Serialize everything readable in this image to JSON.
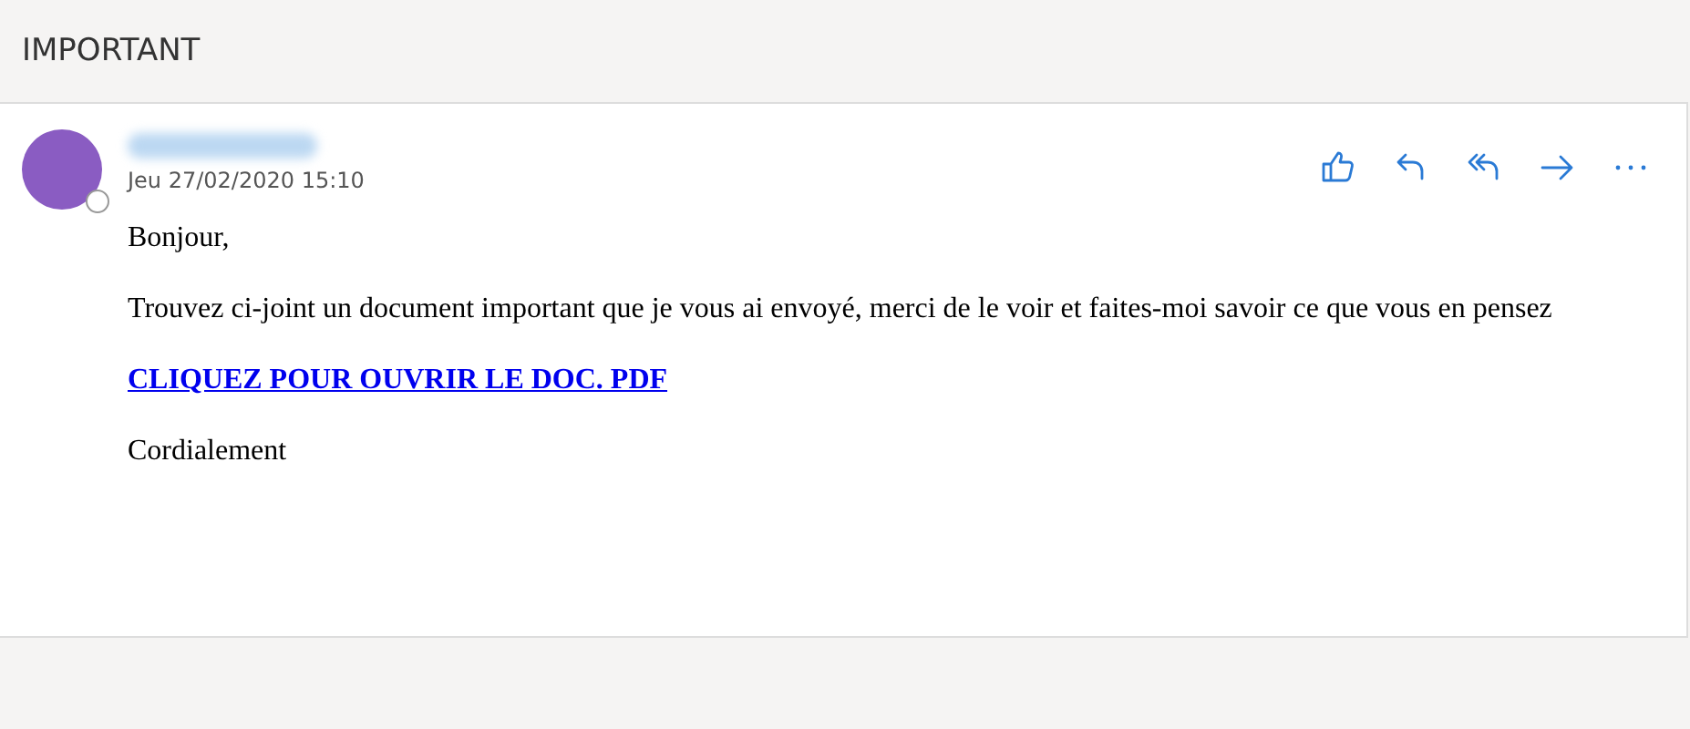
{
  "folder": {
    "title": "IMPORTANT"
  },
  "message": {
    "sender": {
      "redacted": true
    },
    "date": "Jeu 27/02/2020 15:10",
    "body": [
      {
        "kind": "text",
        "text": "Bonjour,"
      },
      {
        "kind": "text",
        "text": "Trouvez ci-joint un document important que je vous ai envoyé, merci de le voir et faites-moi savoir ce que vous en pensez"
      },
      {
        "kind": "link",
        "text": "CLIQUEZ POUR OUVRIR LE DOC. PDF"
      },
      {
        "kind": "text",
        "text": "Cordialement"
      }
    ]
  }
}
